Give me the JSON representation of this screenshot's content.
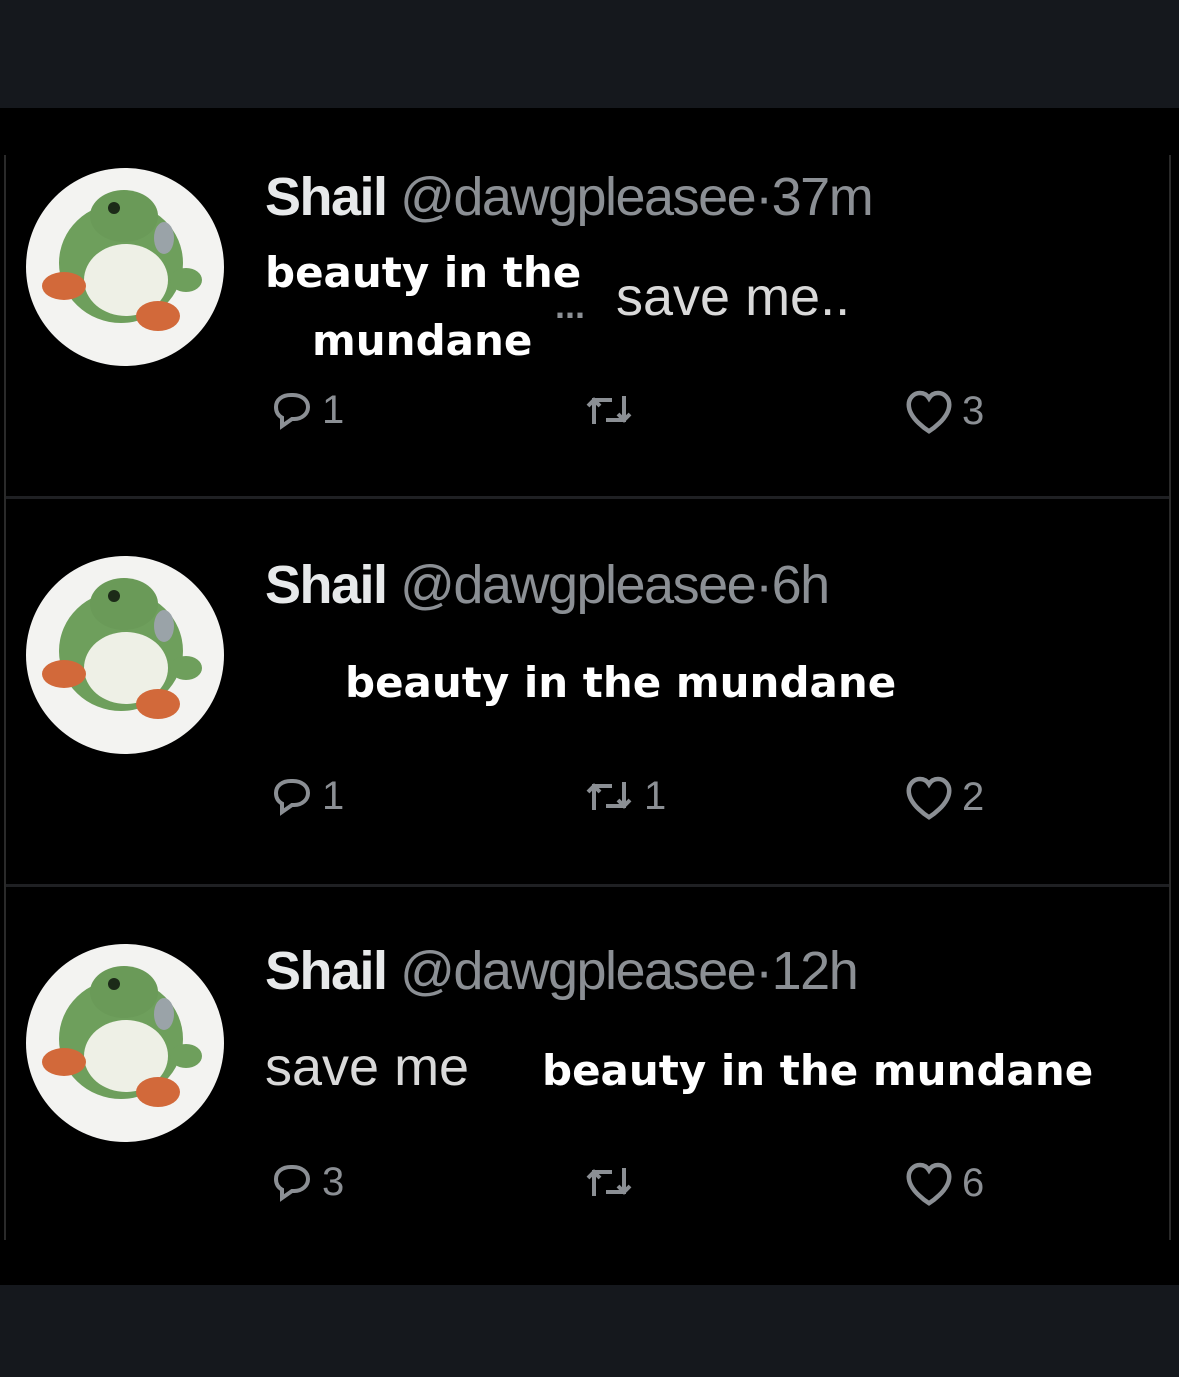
{
  "tweets": [
    {
      "name": "Shail",
      "handle": "@dawgpleasee",
      "separator": "·",
      "time": "37m",
      "text_line1": "beauty in the",
      "text_line2": "mundane",
      "ellipsis": "...",
      "gray_text": "save me..",
      "replies": "1",
      "retweets": "",
      "likes": "3"
    },
    {
      "name": "Shail",
      "handle": "@dawgpleasee",
      "separator": "·",
      "time": "6h",
      "text": "beauty in the mundane",
      "replies": "1",
      "retweets": "1",
      "likes": "2"
    },
    {
      "name": "Shail",
      "handle": "@dawgpleasee",
      "separator": "·",
      "time": "12h",
      "gray_text": "save me",
      "text": "beauty in the mundane",
      "replies": "3",
      "retweets": "",
      "likes": "6"
    }
  ],
  "icons": {
    "avatar": "green-dinosaur-avatar",
    "reply": "reply-icon",
    "retweet": "retweet-icon",
    "like": "heart-icon"
  },
  "colors": {
    "background": "#000000",
    "name": "#e7e9ea",
    "muted": "#8b8f94",
    "text": "#ffffff"
  }
}
